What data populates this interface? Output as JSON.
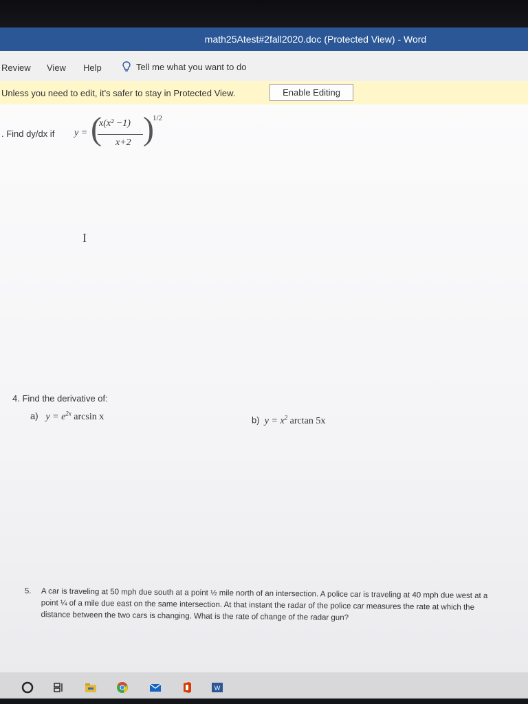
{
  "window": {
    "title": "math25Atest#2fall2020.doc (Protected View) - Word"
  },
  "ribbon": {
    "tabs": [
      "Review",
      "View",
      "Help"
    ],
    "tell_me": "Tell me what you want to do"
  },
  "protected_bar": {
    "message": "Unless you need to edit, it's safer to stay in Protected View.",
    "button": "Enable Editing"
  },
  "document": {
    "q3": {
      "label": ". Find dy/dx if",
      "lhs": "y =",
      "numerator": "x(x² −1)",
      "denominator": "x+2",
      "exponent": "1/2"
    },
    "cursor_glyph": "I",
    "q4": {
      "label": "4.  Find the derivative of:",
      "a_label": "a)",
      "a_expr": "y = e",
      "a_exp": "2x",
      "a_fn": "arcsin x",
      "b_label": "b)",
      "b_expr": "y = x",
      "b_exp": "2",
      "b_fn": "arctan 5x"
    },
    "q5": {
      "number": "5.",
      "text": "A car is traveling at 50 mph due south at a point ½ mile north of an intersection.  A police car is traveling at 40 mph due west at a point ¼ of a mile due east on the same intersection.  At that instant the radar of the police car measures the rate at which the distance between the two cars is changing. What is the rate of change of the radar gun?"
    }
  },
  "taskbar": {
    "icons": [
      "cortana-icon",
      "task-view-icon",
      "file-explorer-icon",
      "chrome-icon",
      "mail-icon",
      "office-icon",
      "word-icon"
    ]
  }
}
